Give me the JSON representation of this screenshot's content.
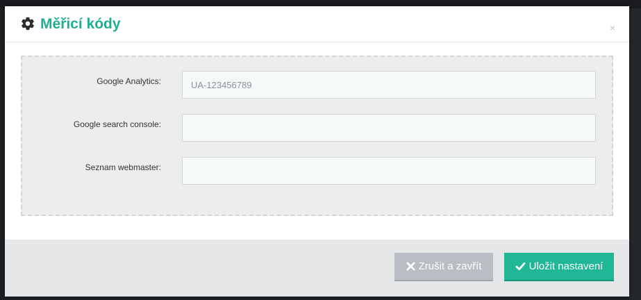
{
  "modal": {
    "title": "Měřicí kódy",
    "title_icon": "gear-icon",
    "close_label": "×"
  },
  "form": {
    "fields": [
      {
        "label": "Google Analytics:",
        "value": "",
        "placeholder": "UA-123456789"
      },
      {
        "label": "Google search console:",
        "value": "",
        "placeholder": ""
      },
      {
        "label": "Seznam webmaster:",
        "value": "",
        "placeholder": ""
      }
    ]
  },
  "footer": {
    "cancel_label": "Zrušit a zavřít",
    "cancel_icon": "close-icon",
    "save_label": "Uložit nastavení",
    "save_icon": "checkmark-icon"
  },
  "colors": {
    "accent": "#1fae8f",
    "save_button": "#1fb796",
    "cancel_button": "#b8bec3"
  }
}
